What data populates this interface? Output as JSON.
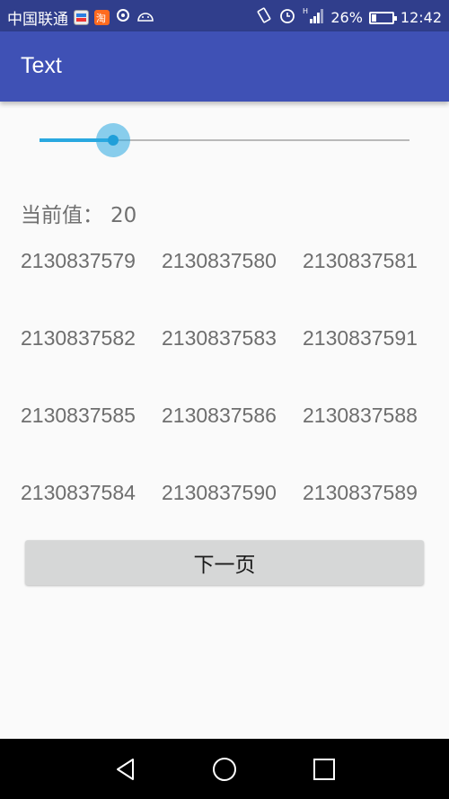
{
  "status_bar": {
    "carrier": "中国联通",
    "battery": "26%",
    "battery_level": 0.26,
    "time": "12:42",
    "icons": [
      "youku-icon",
      "taobao-icon",
      "location-icon",
      "android-icon",
      "vibrate-icon",
      "alarm-icon",
      "signal-icon",
      "battery-icon"
    ]
  },
  "app_bar": {
    "title": "Text"
  },
  "seekbar": {
    "value": 20,
    "max": 100,
    "accent_color": "#29a8e0"
  },
  "current_value": {
    "label": "当前值：",
    "value": "20"
  },
  "grid": {
    "items": [
      "2130837579",
      "2130837580",
      "2130837581",
      "2130837582",
      "2130837583",
      "2130837591",
      "2130837585",
      "2130837586",
      "2130837588",
      "2130837584",
      "2130837590",
      "2130837589"
    ]
  },
  "next_button": {
    "label": "下一页"
  },
  "nav_bar": {
    "buttons": [
      "back",
      "home",
      "recents"
    ]
  }
}
